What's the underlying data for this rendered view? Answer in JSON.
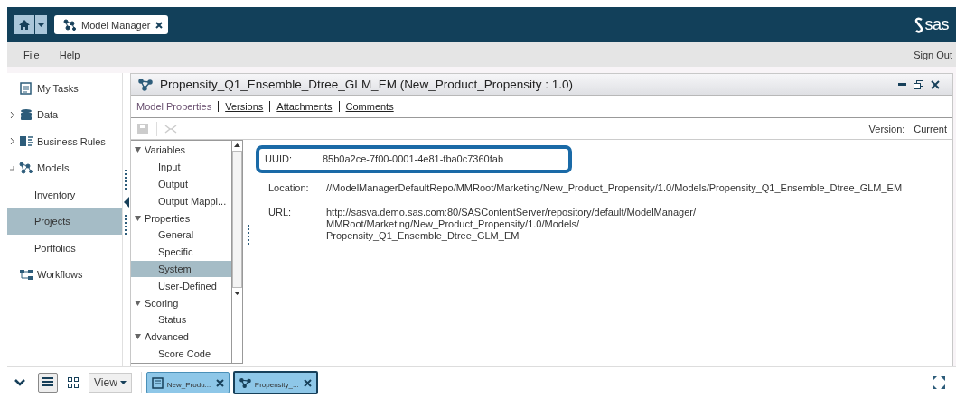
{
  "header": {
    "app_tab": "Model Manager",
    "logo": "sas"
  },
  "menu": {
    "items": [
      "File",
      "Help"
    ],
    "sign_out": "Sign Out"
  },
  "sidebar": {
    "items": [
      {
        "label": "My Tasks",
        "kind": "tasks",
        "selected": false
      },
      {
        "label": "Data",
        "kind": "data",
        "expanded": false,
        "selected": false
      },
      {
        "label": "Business Rules",
        "kind": "rules",
        "expanded": false,
        "selected": false
      },
      {
        "label": "Models",
        "kind": "models",
        "expanded": true,
        "selected": false,
        "children": [
          {
            "label": "Inventory",
            "selected": false
          },
          {
            "label": "Projects",
            "selected": true
          },
          {
            "label": "Portfolios",
            "selected": false
          }
        ]
      },
      {
        "label": "Workflows",
        "kind": "workflows",
        "selected": false
      }
    ]
  },
  "panel": {
    "title": "Propensity_Q1_Ensemble_Dtree_GLM_EM (New_Product_Propensity : 1.0)",
    "tabs": [
      {
        "label": "Model Properties",
        "selected": true
      },
      {
        "label": "Versions",
        "selected": false
      },
      {
        "label": "Attachments",
        "selected": false
      },
      {
        "label": "Comments",
        "selected": false
      }
    ],
    "version_label": "Version:",
    "version_value": "Current",
    "tree": [
      {
        "label": "Variables",
        "expanded": true,
        "children": [
          {
            "label": "Input",
            "selected": false
          },
          {
            "label": "Output",
            "selected": false
          },
          {
            "label": "Output Mappi...",
            "selected": false
          }
        ]
      },
      {
        "label": "Properties",
        "expanded": true,
        "children": [
          {
            "label": "General",
            "selected": false
          },
          {
            "label": "Specific",
            "selected": false
          },
          {
            "label": "System",
            "selected": true
          },
          {
            "label": "User-Defined",
            "selected": false
          }
        ]
      },
      {
        "label": "Scoring",
        "expanded": true,
        "children": [
          {
            "label": "Status",
            "selected": false
          }
        ]
      },
      {
        "label": "Advanced",
        "expanded": true,
        "children": [
          {
            "label": "Score Code",
            "selected": false
          }
        ]
      }
    ],
    "properties": [
      {
        "label": "UUID:",
        "lines": [
          "85b0a2ce-7f00-0001-4e81-fba0c7360fab"
        ],
        "highlighted": true
      },
      {
        "label": "Location:",
        "lines": [
          "//ModelManagerDefaultRepo/MMRoot/Marketing/New_Product_Propensity/1.0/Models/Propensity_Q1_Ensemble_Dtree_GLM_EM"
        ],
        "highlighted": false
      },
      {
        "label": "URL:",
        "lines": [
          "http://sasva.demo.sas.com:80/SASContentServer/repository/default/ModelManager/",
          "MMRoot/Marketing/New_Product_Propensity/1.0/Models/",
          "Propensity_Q1_Ensemble_Dtree_GLM_EM"
        ],
        "highlighted": false
      }
    ]
  },
  "taskbar": {
    "view": "View",
    "windows": [
      {
        "label": "New_Produ...",
        "kind": "doc",
        "selected": false
      },
      {
        "label": "Propensity_...",
        "kind": "model",
        "selected": true
      }
    ]
  }
}
